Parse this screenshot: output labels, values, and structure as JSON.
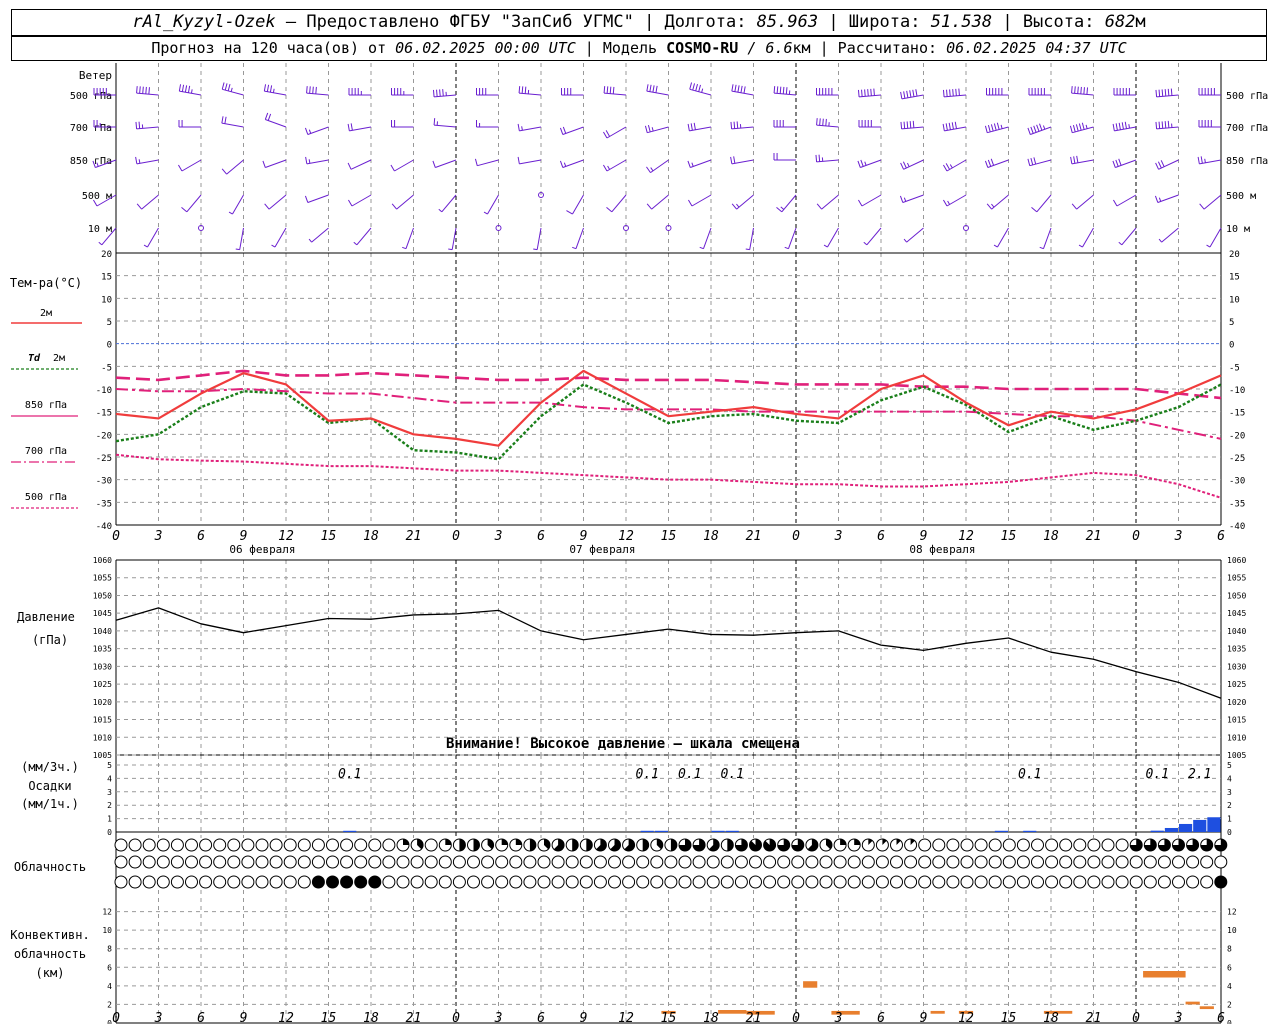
{
  "header": {
    "station": "rAl_Kyzyl-Ozek",
    "provider": " — Предоставлено ФГБУ \"ЗапСиб УГМС\" | Долгота: ",
    "longitude": "85.963",
    "lat_label": " | Широта: ",
    "latitude": "51.538",
    "alt_label": " | Высота: ",
    "altitude": "682",
    "alt_unit": "м",
    "forecast_prefix": "Прогноз на 120 часа(ов) от ",
    "issue_time": "06.02.2025 00:00 UTC",
    "model_prefix": " | Модель ",
    "model": "COSMO-RU",
    "resolution": " / 6.6",
    "res_unit": "км",
    "calc_prefix": " | Рассчитано: ",
    "calc_time": "06.02.2025 04:37 UTC"
  },
  "chart_data": [
    {
      "type": "wind_barbs",
      "title": "Ветер",
      "levels": [
        "500 гПа",
        "700 гПа",
        "850 гПа",
        "500 м",
        "10 м"
      ],
      "x": [
        0,
        3,
        6,
        9,
        12,
        15,
        18,
        21,
        24,
        27,
        30,
        33,
        36,
        39,
        42,
        45,
        48,
        51,
        54,
        57,
        60,
        63,
        66,
        69,
        72,
        75,
        78
      ],
      "direction_deg": {
        "500 гПа": [
          270,
          275,
          280,
          285,
          280,
          275,
          270,
          270,
          265,
          270,
          275,
          270,
          275,
          280,
          285,
          280,
          275,
          270,
          265,
          260,
          265,
          270,
          270,
          275,
          270,
          265,
          270
        ],
        "700 гПа": [
          270,
          265,
          270,
          280,
          290,
          250,
          260,
          270,
          275,
          270,
          260,
          250,
          240,
          255,
          260,
          265,
          270,
          275,
          270,
          265,
          260,
          255,
          250,
          255,
          260,
          265,
          270
        ],
        "850 гПа": [
          250,
          260,
          240,
          230,
          250,
          260,
          245,
          240,
          250,
          255,
          260,
          250,
          240,
          235,
          250,
          260,
          270,
          265,
          250,
          245,
          240,
          250,
          255,
          260,
          250,
          245,
          260
        ],
        "500 м": [
          240,
          230,
          220,
          210,
          230,
          250,
          240,
          230,
          220,
          210,
          200,
          210,
          220,
          230,
          240,
          230,
          220,
          230,
          240,
          250,
          240,
          230,
          220,
          230,
          240,
          250,
          230
        ],
        "10 м": [
          220,
          210,
          200,
          190,
          210,
          230,
          220,
          200,
          190,
          180,
          190,
          200,
          210,
          220,
          200,
          190,
          200,
          210,
          220,
          230,
          220,
          210,
          200,
          210,
          220,
          230,
          210
        ]
      },
      "speed_ms": {
        "500 гПа": [
          20,
          20,
          18,
          15,
          14,
          16,
          18,
          18,
          18,
          17,
          15,
          16,
          16,
          17,
          18,
          20,
          22,
          25,
          26,
          28,
          30,
          32,
          34,
          34,
          33,
          30,
          25
        ],
        "700 гПа": [
          10,
          10,
          8,
          8,
          9,
          7,
          8,
          8,
          6,
          6,
          7,
          8,
          9,
          10,
          12,
          14,
          16,
          18,
          20,
          20,
          21,
          22,
          22,
          22,
          22,
          22,
          20
        ],
        "850 гПа": [
          6,
          6,
          5,
          4,
          5,
          6,
          5,
          5,
          4,
          4,
          5,
          6,
          6,
          6,
          7,
          8,
          9,
          10,
          10,
          10,
          11,
          12,
          12,
          12,
          12,
          12,
          10
        ],
        "500 м": [
          4,
          4,
          4,
          3,
          4,
          5,
          4,
          4,
          3,
          3,
          0,
          4,
          4,
          5,
          5,
          6,
          6,
          5,
          5,
          6,
          6,
          6,
          5,
          5,
          5,
          6,
          5
        ],
        "10 м": [
          3,
          2,
          0,
          2,
          3,
          2,
          2,
          2,
          2,
          0,
          2,
          2,
          0,
          0,
          2,
          2,
          2,
          2,
          2,
          2,
          0,
          2,
          2,
          2,
          2,
          2,
          2
        ]
      }
    },
    {
      "type": "line",
      "title": "Тем-ра(°C)",
      "x_hours": [
        0,
        3,
        6,
        9,
        12,
        15,
        18,
        21,
        24,
        27,
        30,
        33,
        36,
        39,
        42,
        45,
        48,
        51,
        54,
        57,
        60,
        63,
        66,
        69,
        72,
        75,
        78
      ],
      "x_ticks": [
        "0",
        "3",
        "6",
        "9",
        "12",
        "15",
        "18",
        "21",
        "0",
        "3",
        "6",
        "9",
        "12",
        "15",
        "18",
        "21",
        "0",
        "3",
        "6",
        "9",
        "12",
        "15",
        "18",
        "21",
        "0",
        "3",
        "6"
      ],
      "days": [
        "06 февраля",
        "07 февраля",
        "08 февраля"
      ],
      "ylim": [
        -40,
        20
      ],
      "y_ticks": [
        20,
        15,
        10,
        5,
        0,
        -5,
        -10,
        -15,
        -20,
        -25,
        -30,
        -35,
        -40
      ],
      "series": [
        {
          "name": "2м",
          "color": "#f03c3c",
          "values": [
            -15.5,
            -16.5,
            -11,
            -6.5,
            -9,
            -17,
            -16.5,
            -20,
            -21,
            -22.5,
            -13,
            -6,
            -11,
            -16,
            -15,
            -14,
            -15.5,
            -16.5,
            -10,
            -7,
            -13,
            -18,
            -15,
            -16.5,
            -14.5,
            -11,
            -7
          ]
        },
        {
          "name": "Td 2м",
          "color": "#1a7f1a",
          "values": [
            -21.5,
            -20,
            -14,
            -10.5,
            -11,
            -17.5,
            -16.5,
            -23.5,
            -24,
            -25.5,
            -16,
            -9,
            -13,
            -17.5,
            -16,
            -15.5,
            -17,
            -17.5,
            -12.5,
            -9.5,
            -13.5,
            -19.5,
            -16,
            -19,
            -17,
            -14,
            -9
          ]
        },
        {
          "name": "850 гПа",
          "color": "#e0207a",
          "values": [
            -7.5,
            -8,
            -7,
            -6,
            -7,
            -7,
            -6.5,
            -7,
            -7.5,
            -8,
            -8,
            -7.5,
            -8,
            -8,
            -8,
            -8.5,
            -9,
            -9,
            -9,
            -9.5,
            -9.5,
            -10,
            -10,
            -10,
            -10,
            -11,
            -12
          ]
        },
        {
          "name": "700 гПа",
          "color": "#e0207a",
          "values": [
            -10,
            -10.5,
            -10.5,
            -10,
            -10.5,
            -11,
            -11,
            -12,
            -13,
            -13,
            -13,
            -14,
            -14.5,
            -14.5,
            -14.5,
            -15,
            -15,
            -15,
            -15,
            -15,
            -15,
            -15.5,
            -16,
            -16,
            -17,
            -19,
            -21
          ]
        },
        {
          "name": "500 гПа",
          "color": "#e0207a",
          "values": [
            -24.5,
            -25.5,
            -25.8,
            -26,
            -26.5,
            -27,
            -27,
            -27.5,
            -28,
            -28,
            -28.5,
            -29,
            -29.5,
            -30,
            -30,
            -30.5,
            -31,
            -31,
            -31.5,
            -31.5,
            -31,
            -30.5,
            -29.5,
            -28.5,
            -29,
            -31,
            -34
          ]
        }
      ]
    },
    {
      "type": "line",
      "title": "Давление",
      "unit": "(гПа)",
      "x_hours": [
        0,
        3,
        6,
        9,
        12,
        15,
        18,
        21,
        24,
        27,
        30,
        33,
        36,
        39,
        42,
        45,
        48,
        51,
        54,
        57,
        60,
        63,
        66,
        69,
        72,
        75,
        78
      ],
      "ylim": [
        1005,
        1060
      ],
      "y_ticks": [
        1060,
        1055,
        1050,
        1045,
        1040,
        1035,
        1030,
        1025,
        1020,
        1015,
        1010,
        1005
      ],
      "values": [
        1043,
        1046.5,
        1042,
        1039.5,
        1041.5,
        1043.5,
        1043.3,
        1044.5,
        1044.8,
        1045.8,
        1040,
        1037.5,
        1039,
        1040.5,
        1039,
        1038.8,
        1039.5,
        1040,
        1036,
        1034.5,
        1036.5,
        1038,
        1034,
        1032,
        1028.5,
        1025.5,
        1021
      ],
      "warning": "Внимание! Высокое давление — шкала смещена"
    },
    {
      "type": "bar",
      "title": "Осадки",
      "unit_3h": "(мм/3ч.)",
      "unit_1h": "(мм/1ч.)",
      "ylim": [
        0,
        5
      ],
      "y_ticks": [
        5,
        4,
        3,
        2,
        1,
        0
      ],
      "labels_3h": [
        {
          "x": 16.5,
          "text": "0.1"
        },
        {
          "x": 37.5,
          "text": "0.1"
        },
        {
          "x": 40.5,
          "text": "0.1"
        },
        {
          "x": 43.5,
          "text": "0.1"
        },
        {
          "x": 64.5,
          "text": "0.1"
        },
        {
          "x": 73.5,
          "text": "0.1"
        },
        {
          "x": 76.5,
          "text": "2.1"
        }
      ],
      "bars_1h": [
        {
          "x": 17,
          "value": 0.05
        },
        {
          "x": 38,
          "value": 0.05
        },
        {
          "x": 39,
          "value": 0.05
        },
        {
          "x": 43,
          "value": 0.04
        },
        {
          "x": 44,
          "value": 0.04
        },
        {
          "x": 63,
          "value": 0.04
        },
        {
          "x": 65,
          "value": 0.04
        },
        {
          "x": 74,
          "value": 0.1
        },
        {
          "x": 75,
          "value": 0.3
        },
        {
          "x": 76,
          "value": 0.6
        },
        {
          "x": 77,
          "value": 0.9
        },
        {
          "x": 78,
          "value": 1.1
        }
      ]
    },
    {
      "type": "cloud_cover",
      "title": "Облачность",
      "rows": [
        "upper",
        "middle",
        "lower"
      ],
      "note": "octas 0-8 per 1h step, 79 steps",
      "upper": [
        0,
        0,
        0,
        0,
        0,
        0,
        0,
        0,
        0,
        0,
        0,
        0,
        0,
        0,
        0,
        0,
        0,
        0,
        0,
        0,
        2,
        3,
        0,
        2,
        4,
        4,
        3,
        2,
        2,
        4,
        3,
        5,
        4,
        4,
        5,
        5,
        5,
        4,
        3,
        4,
        6,
        6,
        5,
        4,
        6,
        7,
        7,
        6,
        6,
        5,
        3,
        2,
        2,
        1,
        1,
        1,
        1,
        0,
        0,
        0,
        0,
        0,
        0,
        0,
        0,
        0,
        0,
        0,
        0,
        0,
        0,
        0,
        6,
        6,
        6,
        6,
        6,
        6,
        6
      ],
      "middle": [
        0,
        0,
        0,
        0,
        0,
        0,
        0,
        0,
        0,
        0,
        0,
        0,
        0,
        0,
        0,
        0,
        0,
        0,
        0,
        0,
        0,
        0,
        0,
        0,
        0,
        0,
        0,
        0,
        0,
        0,
        0,
        0,
        0,
        0,
        0,
        0,
        0,
        0,
        0,
        0,
        0,
        0,
        0,
        0,
        0,
        0,
        0,
        0,
        0,
        0,
        0,
        0,
        0,
        0,
        0,
        0,
        0,
        0,
        0,
        0,
        0,
        0,
        0,
        0,
        0,
        0,
        0,
        0,
        0,
        0,
        0,
        0,
        0,
        0,
        0,
        0,
        0,
        0,
        0
      ],
      "lower": [
        0,
        0,
        0,
        0,
        0,
        0,
        0,
        0,
        0,
        0,
        0,
        0,
        0,
        0,
        8,
        8,
        8,
        8,
        8,
        0,
        0,
        0,
        0,
        0,
        0,
        0,
        0,
        0,
        0,
        0,
        0,
        0,
        0,
        0,
        0,
        0,
        0,
        0,
        0,
        0,
        0,
        0,
        0,
        0,
        0,
        0,
        0,
        0,
        0,
        0,
        0,
        0,
        0,
        0,
        0,
        0,
        0,
        0,
        0,
        0,
        0,
        0,
        0,
        0,
        0,
        0,
        0,
        0,
        0,
        0,
        0,
        0,
        0,
        0,
        0,
        0,
        0,
        0,
        8
      ]
    },
    {
      "type": "bar",
      "title": "Конвективн. облачность",
      "unit": "(км)",
      "ylim": [
        0,
        14
      ],
      "y_ticks": [
        12,
        10,
        8,
        6,
        4,
        2,
        0
      ],
      "x_ticks": [
        "0",
        "3",
        "6",
        "9",
        "12",
        "15",
        "18",
        "21",
        "0",
        "3",
        "6",
        "9",
        "12",
        "15",
        "18",
        "21",
        "0",
        "3",
        "6",
        "9",
        "12",
        "15",
        "18",
        "21",
        "0",
        "3",
        "6"
      ],
      "ranges": [
        {
          "x0": 38.5,
          "x1": 39.5,
          "bottom": 1.0,
          "top": 1.3
        },
        {
          "x0": 42.5,
          "x1": 44.5,
          "bottom": 1.0,
          "top": 1.4
        },
        {
          "x0": 44.5,
          "x1": 46.5,
          "bottom": 0.9,
          "top": 1.3
        },
        {
          "x0": 48.5,
          "x1": 49.5,
          "bottom": 3.8,
          "top": 4.5
        },
        {
          "x0": 50.5,
          "x1": 52.5,
          "bottom": 0.9,
          "top": 1.3
        },
        {
          "x0": 57.5,
          "x1": 58.5,
          "bottom": 1.0,
          "top": 1.3
        },
        {
          "x0": 59.5,
          "x1": 60.5,
          "bottom": 1.0,
          "top": 1.3
        },
        {
          "x0": 65.5,
          "x1": 67.5,
          "bottom": 1.0,
          "top": 1.3
        },
        {
          "x0": 72.5,
          "x1": 75.5,
          "bottom": 4.9,
          "top": 5.6
        },
        {
          "x0": 75.5,
          "x1": 76.5,
          "bottom": 2.0,
          "top": 2.3
        },
        {
          "x0": 76.5,
          "x1": 77.5,
          "bottom": 1.5,
          "top": 1.8
        }
      ]
    }
  ],
  "legend": {
    "wind": "Ветер",
    "temp_title": "Тем-ра(°C)",
    "t2m": "2м",
    "td_prefix": "Td",
    "td_level": "2м",
    "l850": "850 гПа",
    "l700": "700 гПа",
    "l500": "500 гПа",
    "pressure": "Давление",
    "pressure_unit": "(гПа)",
    "precip_3h": "(мм/3ч.)",
    "precip": "Осадки",
    "precip_1h": "(мм/1ч.)",
    "cloud": "Облачность",
    "conv1": "Конвективн.",
    "conv2": "облачность",
    "conv3": "(км)"
  }
}
